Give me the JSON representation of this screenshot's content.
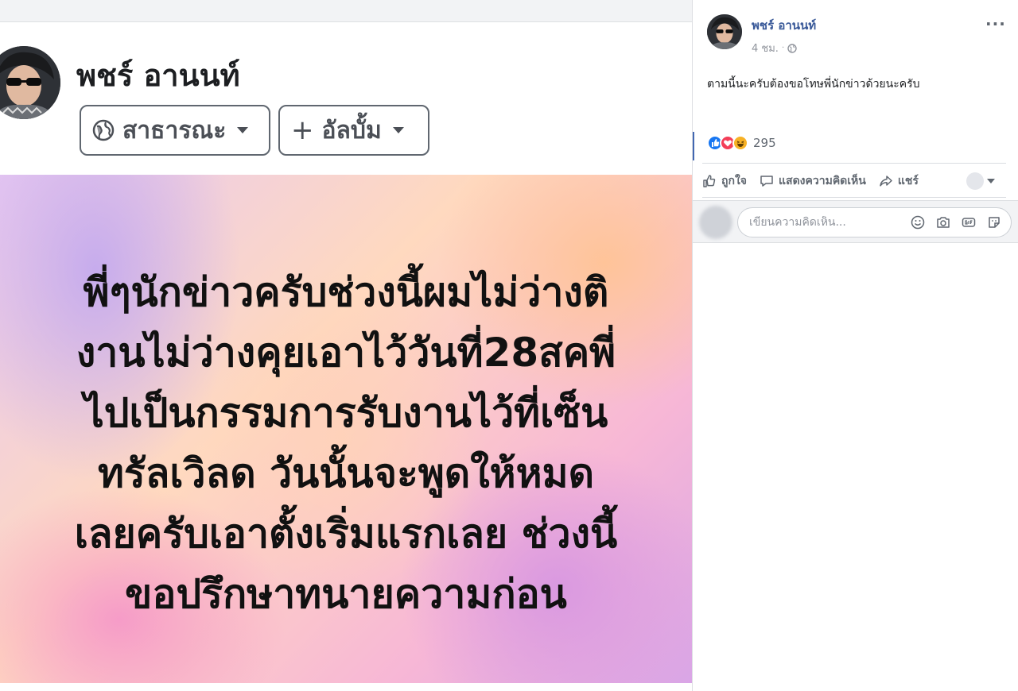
{
  "left_panel": {
    "profile": {
      "name": "พชร์ อานนท์"
    },
    "privacy_selector": {
      "label": "สาธารณะ"
    },
    "album_button": {
      "plus": "+",
      "label": "อัลบั้ม"
    },
    "post_image_text": [
      "พี่ๆนักข่าวครับช่วงนี้ผมไม่ว่างติ",
      "งานไม่ว่างคุยเอาไว้วันที่28สคพี่",
      "ไปเป็นกรรมการรับงานไว้ที่เซ็น",
      "ทรัลเวิลด วันนั้นจะพูดให้หมด",
      "เลยครับเอาตั้งเริ่มแรกเลย ช่วงนี้",
      "ขอปรึกษาทนายความก่อน"
    ]
  },
  "right_panel": {
    "author": {
      "name": "พชร์ อานนท์",
      "time": "4 ชม.",
      "dot": "·"
    },
    "more": "···",
    "caption": "ตามนี้นะครับต้องขอโทษพี่นักข่าวด้วยนะครับ",
    "reactions": {
      "types": [
        "like",
        "love",
        "haha"
      ],
      "count": "295"
    },
    "actions": {
      "like": "ถูกใจ",
      "comment": "แสดงความคิดเห็น",
      "share": "แชร์"
    },
    "comment_box": {
      "placeholder": "เขียนความคิดเห็น..."
    }
  },
  "colors": {
    "link": "#385898",
    "like": "#1877f2",
    "love": "#f33e58",
    "haha": "#f7b125"
  }
}
